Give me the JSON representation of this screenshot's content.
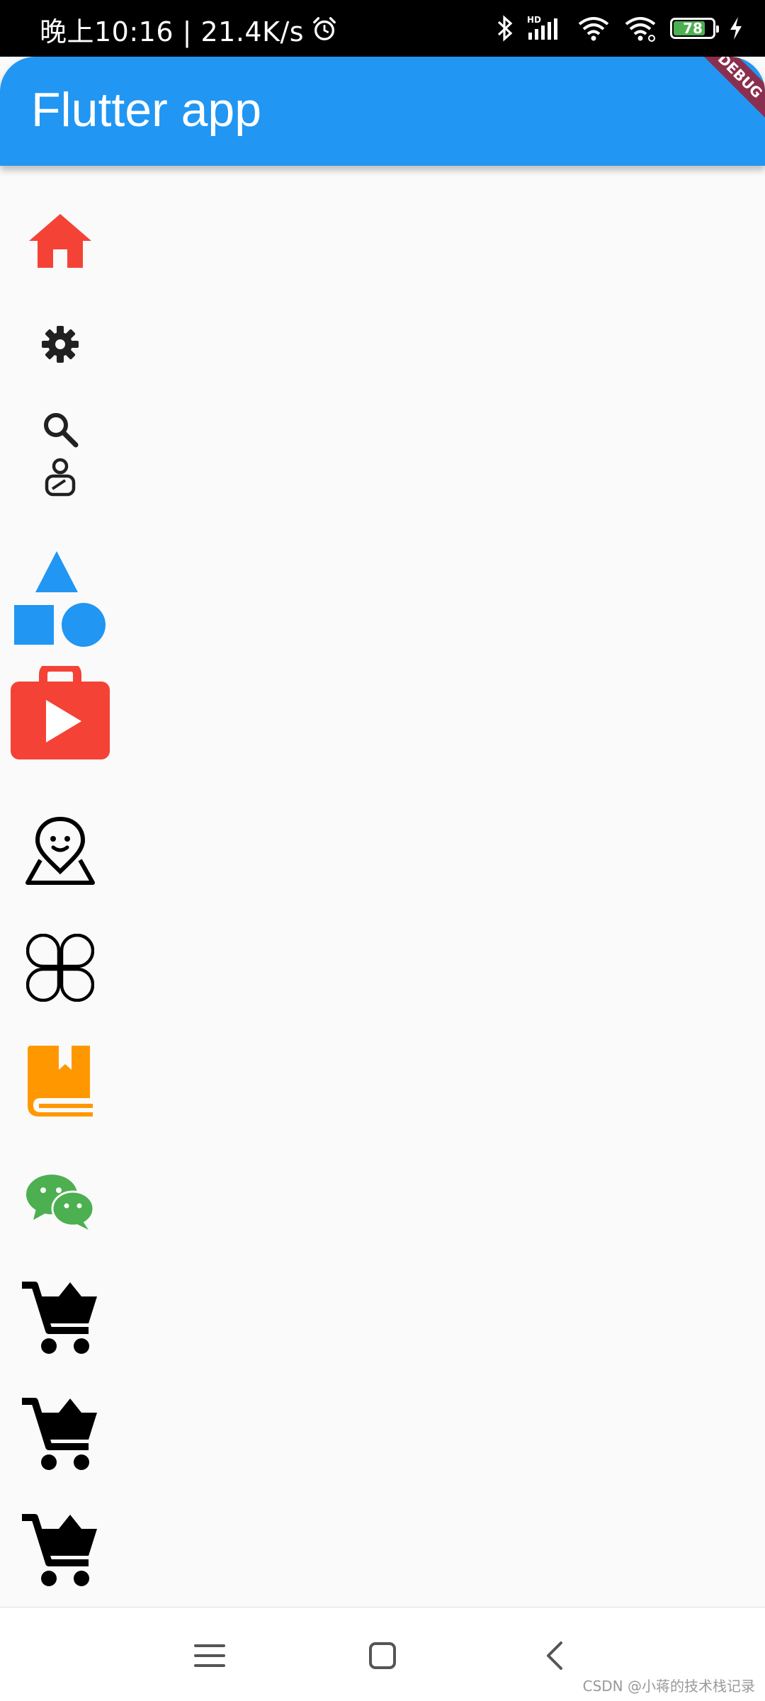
{
  "status_bar": {
    "time_speed": "晚上10:16 | 21.4K/s",
    "battery": "78",
    "icons": [
      "alarm-icon",
      "bluetooth-icon",
      "hd-signal-icon",
      "wifi-icon",
      "wifi-link-icon",
      "battery-icon",
      "charging-icon"
    ]
  },
  "app_bar": {
    "title": "Flutter app",
    "debug_banner": "DEBUG",
    "color": "#2196f3"
  },
  "icons": [
    {
      "name": "home-icon",
      "color": "#f44336"
    },
    {
      "name": "settings-icon",
      "color": "#212121"
    },
    {
      "name": "search-icon",
      "color": "#212121"
    },
    {
      "name": "person-icon",
      "color": "#212121"
    },
    {
      "name": "shapes-icon",
      "color": "#2196f3"
    },
    {
      "name": "shop-play-icon",
      "color": "#f44336"
    },
    {
      "name": "location-face-icon",
      "color": "#000000"
    },
    {
      "name": "clover-icon",
      "color": "#000000"
    },
    {
      "name": "book-icon",
      "color": "#ff9800"
    },
    {
      "name": "wechat-icon",
      "color": "#4caf50"
    },
    {
      "name": "shopping-cart-icon",
      "color": "#000000"
    },
    {
      "name": "shopping-cart-icon",
      "color": "#000000"
    },
    {
      "name": "shopping-cart-icon",
      "color": "#000000"
    }
  ],
  "nav_bar": {
    "buttons": [
      "menu-icon",
      "home-square-icon",
      "back-chevron-icon"
    ]
  },
  "watermark": "CSDN @小蒋的技术栈记录"
}
